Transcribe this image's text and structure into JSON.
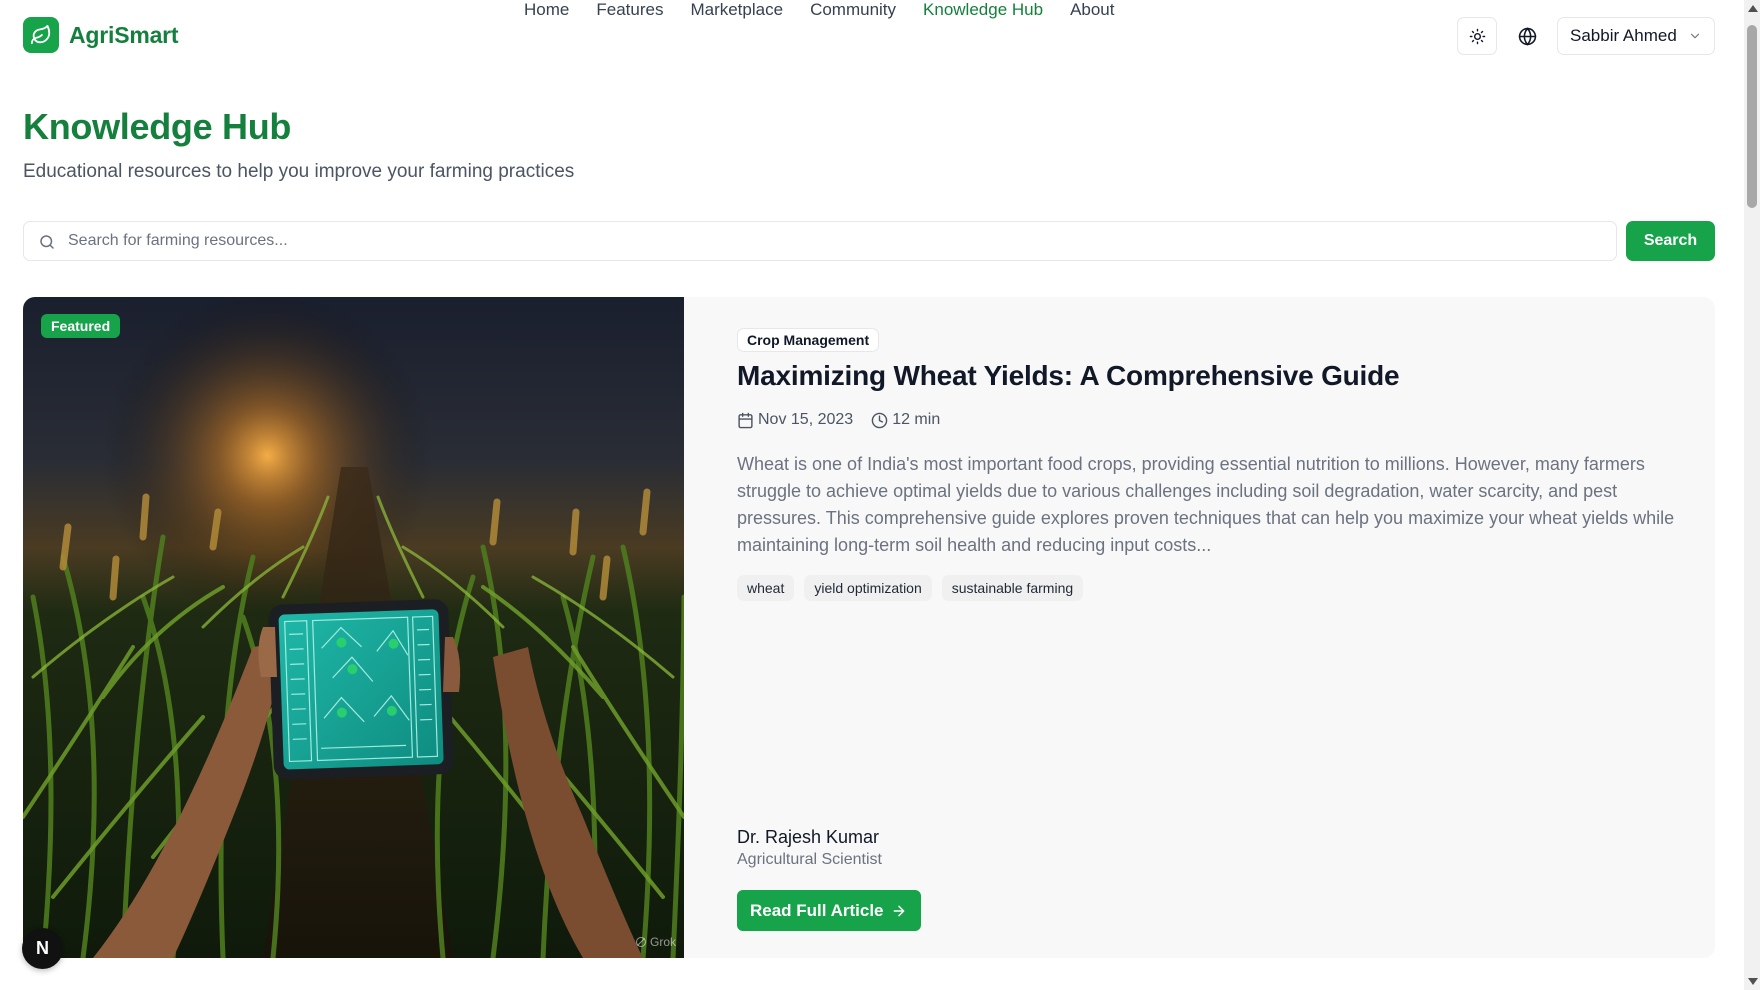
{
  "brand": {
    "name": "AgriSmart",
    "accent": "#16a34a",
    "accent_dark": "#15803d"
  },
  "nav": {
    "items": [
      {
        "label": "Home",
        "active": false
      },
      {
        "label": "Features",
        "active": false
      },
      {
        "label": "Marketplace",
        "active": false
      },
      {
        "label": "Community",
        "active": false
      },
      {
        "label": "Knowledge Hub",
        "active": true
      },
      {
        "label": "About",
        "active": false
      }
    ]
  },
  "header": {
    "theme_icon": "sun-icon",
    "language_icon": "globe-icon",
    "user": {
      "name": "Sabbir Ahmed"
    }
  },
  "page": {
    "title": "Knowledge Hub",
    "subtitle": "Educational resources to help you improve your farming practices"
  },
  "search": {
    "placeholder": "Search for farming resources...",
    "value": "",
    "button_label": "Search"
  },
  "featured": {
    "badge": "Featured",
    "watermark": "Grok",
    "category": "Crop Management",
    "title": "Maximizing Wheat Yields: A Comprehensive Guide",
    "date": "Nov 15, 2023",
    "read_time": "12 min",
    "excerpt": "Wheat is one of India's most important food crops, providing essential nutrition to millions. However, many farmers struggle to achieve optimal yields due to various challenges including soil degradation, water scarcity, and pest pressures. This comprehensive guide explores proven techniques that can help you maximize your wheat yields while maintaining long-term soil health and reducing input costs...",
    "tags": [
      "wheat",
      "yield optimization",
      "sustainable farming"
    ],
    "author": {
      "name": "Dr. Rajesh Kumar",
      "role": "Agricultural Scientist"
    },
    "cta_label": "Read Full Article"
  },
  "dev_badge": {
    "label": "N"
  }
}
